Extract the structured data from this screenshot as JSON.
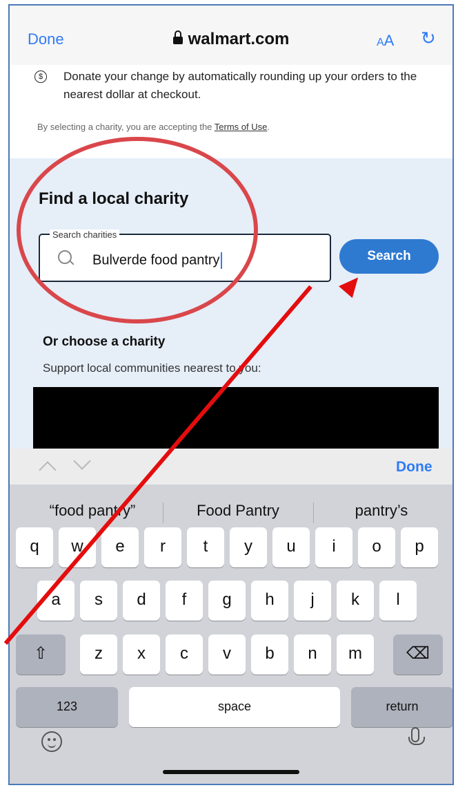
{
  "browser": {
    "done_label": "Done",
    "site": "walmart.com",
    "text_size_label": "AA",
    "reload_icon": "reload-icon"
  },
  "content": {
    "round_up_text": "Donate your change by automatically rounding up your orders to the nearest dollar at checkout.",
    "terms_prefix": "By selecting a charity, you are accepting the ",
    "terms_link": "Terms of Use",
    "terms_suffix": ".",
    "find_title": "Find a local charity",
    "search": {
      "legend": "Search charities",
      "value": "Bulverde food pantry",
      "button_label": "Search"
    },
    "or_choose": "Or choose a charity",
    "support_text": "Support local communities nearest to you:"
  },
  "keyboard": {
    "done_label": "Done",
    "predictions": [
      "“food pantry”",
      "Food Pantry",
      "pantry’s"
    ],
    "row1": [
      "q",
      "w",
      "e",
      "r",
      "t",
      "y",
      "u",
      "i",
      "o",
      "p"
    ],
    "row2": [
      "a",
      "s",
      "d",
      "f",
      "g",
      "h",
      "j",
      "k",
      "l"
    ],
    "row3": [
      "z",
      "x",
      "c",
      "v",
      "b",
      "n",
      "m"
    ],
    "numbers_label": "123",
    "space_label": "space",
    "return_label": "return"
  },
  "colors": {
    "accent_blue": "#2f7bf5",
    "button_blue": "#2f7ad1",
    "section_bg": "#e6eef8",
    "annotation_red": "#e40d0d"
  }
}
